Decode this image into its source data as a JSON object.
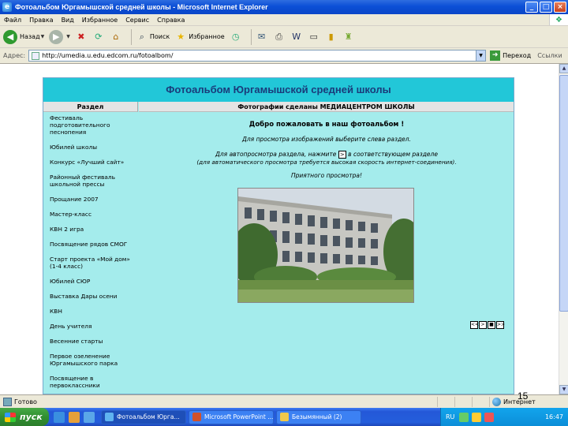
{
  "window": {
    "title": "Фотоальбом Юргамышской средней школы - Microsoft Internet Explorer",
    "controls": [
      "_",
      "□",
      "×"
    ]
  },
  "menu": [
    "Файл",
    "Правка",
    "Вид",
    "Избранное",
    "Сервис",
    "Справка"
  ],
  "toolbar": {
    "back_label": "Назад",
    "search_label": "Поиск",
    "favorites_label": "Избранное"
  },
  "address": {
    "label": "Адрес:",
    "url": "http://umedia.u.edu.edcom.ru/fotoalbom/",
    "go_label": "Переход",
    "links_label": "Ссылки"
  },
  "page": {
    "title": "Фотоальбом Юргамышской средней школы",
    "col_section": "Раздел",
    "col_photos": "Фотографии сделаны МЕДИАЦЕНТРОМ ШКОЛЫ",
    "sections": [
      "Фестиваль подготовительного песнопения",
      "Юбилей школы",
      "Конкурс «Лучший сайт»",
      "Районный фестиваль школьной прессы",
      "Прощание 2007",
      "Мастер-класс",
      "КВН 2 игра",
      "Посвящение рядов СМОГ",
      "Старт проекта «Мой дом» (1-4 класс)",
      "Юбилей СЮР",
      "Выставка Дары осени",
      "КВН",
      "День учителя",
      "Весенние старты",
      "Первое озеленение Юргамышского парка",
      "Посвящение в первоклассники"
    ],
    "welcome": "Добро пожаловать в наш фотоальбом !",
    "hint_select": "Для просмотра изображений выберите слева раздел.",
    "hint_auto_a": "Для автопросмотра раздела, нажмите",
    "hint_auto_btn": ">",
    "hint_auto_b": "в соответствующем разделе",
    "hint_auto_note": "(для автоматического просмотра требуется высокая скорость интернет-соединения).",
    "enjoy": "Приятного просмотра!",
    "nav_buttons": [
      "<<",
      ">",
      "■",
      ">>"
    ]
  },
  "status": {
    "text": "Готово",
    "zone": "Интернет"
  },
  "slide_number": "15",
  "taskbar": {
    "start": "пуск",
    "tasks": [
      "Фотоальбом Юрга...",
      "Microsoft PowerPoint ...",
      "Безымянный (2)"
    ],
    "lang": "RU",
    "time": "16:47"
  },
  "colors": {
    "page_bg": "#a4ecec",
    "title_bar": "#22c7d8",
    "title_text": "#1a3b7a"
  }
}
